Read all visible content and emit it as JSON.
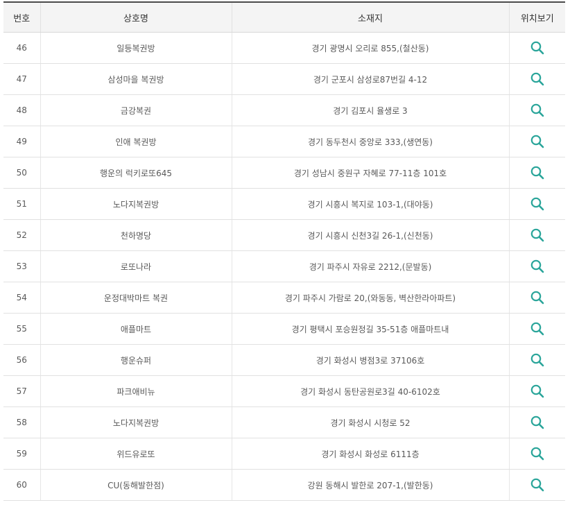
{
  "table": {
    "headers": {
      "number": "번호",
      "name": "상호명",
      "address": "소재지",
      "location": "위치보기"
    },
    "icon": "search-icon",
    "accent_color": "#2aa59a",
    "rows": [
      {
        "number": "46",
        "name": "일등복권방",
        "address": "경기 광명시 오리로 855,(철산동)"
      },
      {
        "number": "47",
        "name": "삼성마을 복권방",
        "address": "경기 군포시 삼성로87번길 4-12"
      },
      {
        "number": "48",
        "name": "금강복권",
        "address": "경기 김포시 율생로 3"
      },
      {
        "number": "49",
        "name": "인애 복권방",
        "address": "경기 동두천시 중앙로 333,(생연동)"
      },
      {
        "number": "50",
        "name": "행운의 럭키로또645",
        "address": "경기 성남시 중원구 자혜로 77-11층 101호"
      },
      {
        "number": "51",
        "name": "노다지복권방",
        "address": "경기 시흥시 복지로 103-1,(대야동)"
      },
      {
        "number": "52",
        "name": "천하명당",
        "address": "경기 시흥시 신천3길 26-1,(신천동)"
      },
      {
        "number": "53",
        "name": "로또나라",
        "address": "경기 파주시 자유로 2212,(문발동)"
      },
      {
        "number": "54",
        "name": "운정대박마트 복권",
        "address": "경기 파주시 가람로 20,(와동동, 벽산한라아파트)"
      },
      {
        "number": "55",
        "name": "애플마트",
        "address": "경기 평택시 포승원정길 35-51층 애플마트내"
      },
      {
        "number": "56",
        "name": "행운슈퍼",
        "address": "경기 화성시 병점3로 37106호"
      },
      {
        "number": "57",
        "name": "파크애비뉴",
        "address": "경기 화성시 동탄공원로3길 40-6102호"
      },
      {
        "number": "58",
        "name": "노다지복권방",
        "address": "경기 화성시 시청로 52"
      },
      {
        "number": "59",
        "name": "위드유로또",
        "address": "경기 화성시 화성로 6111층"
      },
      {
        "number": "60",
        "name": "CU(동해발한점)",
        "address": "강원 동해시 발한로 207-1,(발한동)"
      }
    ]
  }
}
